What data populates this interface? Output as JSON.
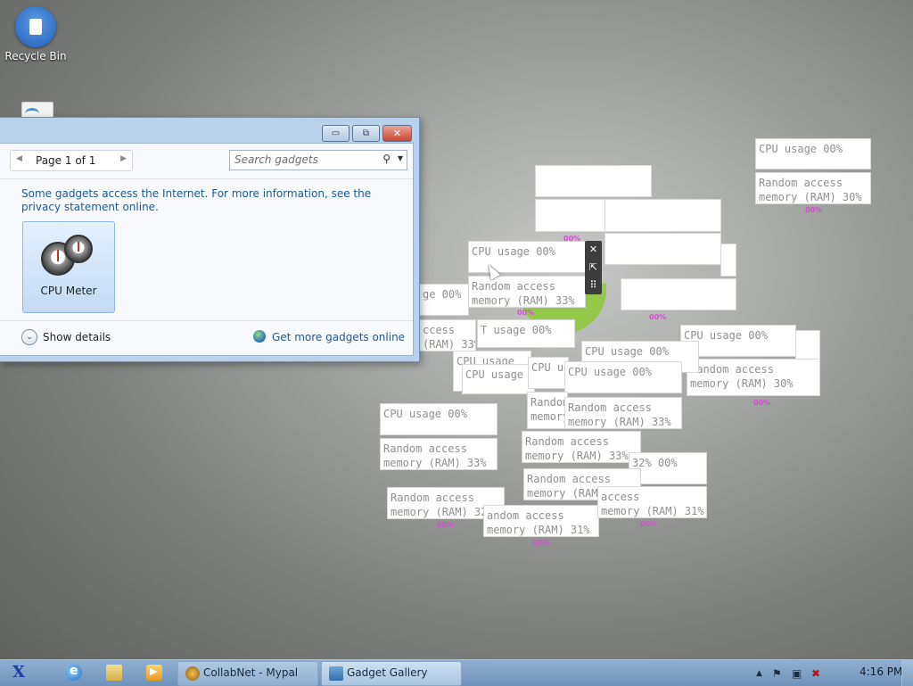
{
  "desktop": {
    "recycle_bin_label": "Recycle Bin"
  },
  "gadget_window": {
    "pager_text": "Page 1 of 1",
    "search_placeholder": "Search gadgets",
    "notice_text": "Some gadgets access the Internet.  For more information, see the privacy statement online.",
    "tile_label": "CPU Meter",
    "show_details": "Show details",
    "get_more": "Get more gadgets online",
    "buttons": {
      "minimize": "▭",
      "restore": "⧉",
      "close": "✕"
    }
  },
  "gadgets": {
    "g1_cpu": "CPU usage 00%",
    "g1_ram": "Random access\nmemory (RAM) 30%",
    "g1_pct": "00%",
    "g2_cpu": "CPU usage 00%",
    "g2_ram": "Random access\nmemory (RAM) 33%",
    "g2_pct": "00%",
    "g3_cpu": "CPU usage 00%",
    "g3_ram": "Random access\nmemory (RAM) 30%",
    "g3_pct": "00%",
    "g4_cpu": "CPU usage 00%",
    "g4_ram": "Random access\nmemory (RAM) 33%",
    "g4_pct": "00%",
    "g5_cpu": "CPU usage 00%",
    "g5_ram": "Random access\nmemory (RAM) 33%",
    "g6_cpu": "CPU usage 00%",
    "g6_ram": "Random access\nmemory (RAM) 33%",
    "g7_ram": "Random access\nmemory (RAM) 32%",
    "g7_pct": "00%",
    "g8_ram": "Random access\nmemory (RAM) 32%",
    "g9_ram": "andom access\nmemory (RAM) 31%",
    "g9_pct": "00%",
    "g10_ram": "access\nmemory (RAM) 31%",
    "g10_pct": "00%",
    "g11_cpu": "32% 00%",
    "g12_cpu": "CPU usage 00%",
    "g13_cpu": "CPU usage 00%",
    "g14_cpu": "ge 00%",
    "g15_ram": "ccess\n(RAM) 33%",
    "g16_cpu": "T usage 00%",
    "g17_cpu": "CPU usage",
    "g18_cpu": "CPU usage",
    "g19_cpu": "CPU u",
    "g20_ram": "Random a\nmemory (",
    "g21_pct": "00%",
    "g22_pct": "00%"
  },
  "gadget_controls": {
    "close": "✕",
    "resize": "⇱",
    "grip": "⠿"
  },
  "taskbar": {
    "start_glyph": "X",
    "task1": "CollabNet - Mypal",
    "task2": "Gadget Gallery",
    "clock": "4:16 PM",
    "tray_icons": [
      "up-arrow-icon",
      "flag-icon",
      "network-icon",
      "volume-muted-icon"
    ]
  }
}
